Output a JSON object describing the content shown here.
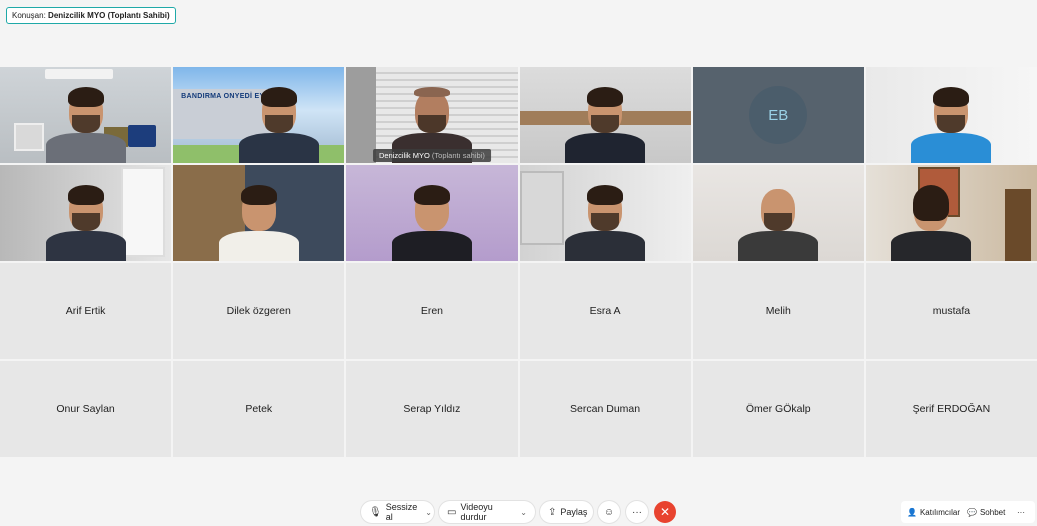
{
  "speaker": {
    "prefix": "Konuşan:",
    "name": "Denizcilik MYO (Toplantı Sahibi)"
  },
  "video_tiles": [
    {
      "id": "v1"
    },
    {
      "id": "v2",
      "sign": "BANDIRMA ONYEDİ EYLÜL ÜN"
    },
    {
      "id": "v3",
      "label_name": "Denizcilik MYO",
      "label_role": "(Toplantı sahibi)",
      "active": true
    },
    {
      "id": "v4"
    },
    {
      "id": "v5",
      "initials": "EB"
    },
    {
      "id": "v6"
    },
    {
      "id": "v7"
    },
    {
      "id": "v8"
    },
    {
      "id": "v9"
    },
    {
      "id": "v10"
    },
    {
      "id": "v11"
    },
    {
      "id": "v12"
    }
  ],
  "participants": [
    "Arif Ertik",
    "Dilek özgeren",
    "Eren",
    "Esra A",
    "Melih",
    "mustafa",
    "Onur Saylan",
    "Petek",
    "Serap Yıldız",
    "Sercan Duman",
    "Ömer GÖkalp",
    "Şerif ERDOĞAN"
  ],
  "toolbar": {
    "mute_label": "Sessize al",
    "video_label": "Videoyu durdur",
    "share_label": "Paylaş",
    "reactions_icon": "smiley-icon",
    "more_icon": "ellipsis-icon",
    "end_icon": "close-icon",
    "participants_label": "Katılımcılar",
    "chat_label": "Sohbet",
    "overflow_icon": "ellipsis-icon",
    "end_color": "#e8432f",
    "accent_color": "#2bb3c4"
  }
}
